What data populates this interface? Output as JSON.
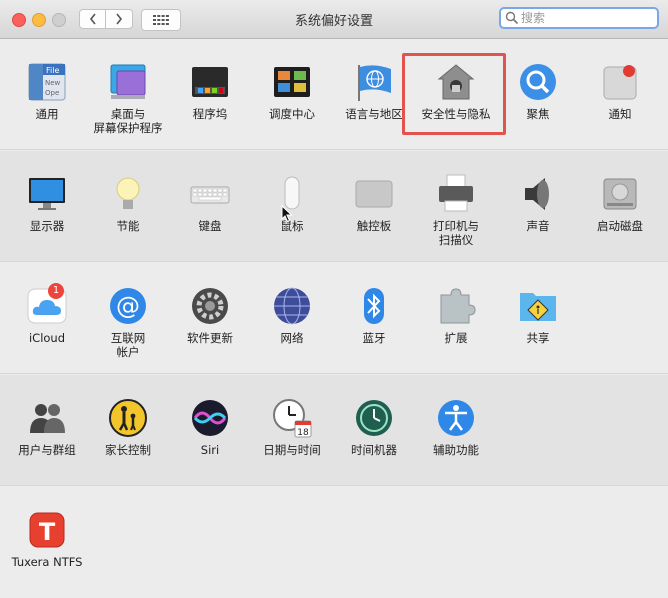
{
  "window": {
    "title": "系统偏好设置"
  },
  "search": {
    "placeholder": "搜索"
  },
  "icloud_badge": "1",
  "calendar_day": "18",
  "rows": [
    [
      {
        "label": "通用"
      },
      {
        "label": "桌面与\n屏幕保护程序"
      },
      {
        "label": "程序坞"
      },
      {
        "label": "调度中心"
      },
      {
        "label": "语言与地区"
      },
      {
        "label": "安全性与隐私"
      },
      {
        "label": "聚焦"
      },
      {
        "label": "通知"
      }
    ],
    [
      {
        "label": "显示器"
      },
      {
        "label": "节能"
      },
      {
        "label": "键盘"
      },
      {
        "label": "鼠标"
      },
      {
        "label": "触控板"
      },
      {
        "label": "打印机与\n扫描仪"
      },
      {
        "label": "声音"
      },
      {
        "label": "启动磁盘"
      }
    ],
    [
      {
        "label": "iCloud"
      },
      {
        "label": "互联网\n帐户"
      },
      {
        "label": "软件更新"
      },
      {
        "label": "网络"
      },
      {
        "label": "蓝牙"
      },
      {
        "label": "扩展"
      },
      {
        "label": "共享"
      }
    ],
    [
      {
        "label": "用户与群组"
      },
      {
        "label": "家长控制"
      },
      {
        "label": "Siri"
      },
      {
        "label": "日期与时间"
      },
      {
        "label": "时间机器"
      },
      {
        "label": "辅助功能"
      }
    ],
    [
      {
        "label": "Tuxera NTFS"
      }
    ]
  ]
}
